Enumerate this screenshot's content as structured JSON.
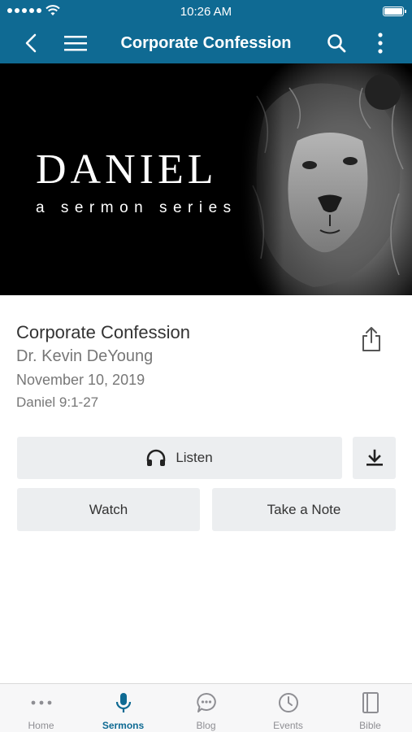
{
  "status_bar": {
    "time": "10:26 AM"
  },
  "nav": {
    "title": "Corporate Confession",
    "icons": [
      "back-chevron-icon",
      "menu-icon",
      "search-icon",
      "more-vertical-icon"
    ]
  },
  "banner": {
    "title": "DANIEL",
    "subtitle": "a sermon series"
  },
  "sermon": {
    "title": "Corporate Confession",
    "speaker": "Dr. Kevin DeYoung",
    "date": "November 10, 2019",
    "passage": "Daniel 9:1-27"
  },
  "actions": {
    "listen": "Listen",
    "watch": "Watch",
    "take_note": "Take a Note"
  },
  "tabs": [
    {
      "label": "Home",
      "icon": "more-dots-icon"
    },
    {
      "label": "Sermons",
      "icon": "microphone-icon",
      "active": true
    },
    {
      "label": "Blog",
      "icon": "chat-bubble-icon"
    },
    {
      "label": "Events",
      "icon": "clock-icon"
    },
    {
      "label": "Bible",
      "icon": "book-icon"
    }
  ],
  "colors": {
    "accent": "#0f6a93",
    "button_bg": "#eceef0",
    "inactive_tab": "#8e8e93"
  }
}
